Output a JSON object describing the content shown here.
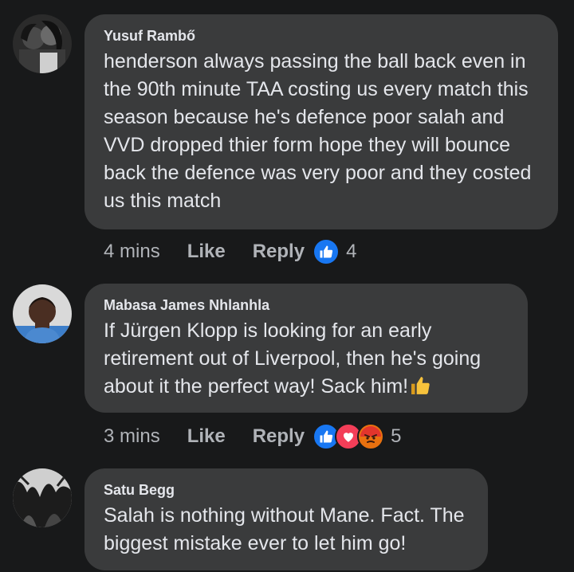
{
  "comments": [
    {
      "author": "Yusuf Rambő",
      "text": "henderson always passing the ball back even in the 90th minute TAA costing us every match this season because he's defence poor salah and VVD dropped thier form hope they will bounce back the defence was very poor and they costed us this match",
      "time": "4 mins",
      "like_label": "Like",
      "reply_label": "Reply",
      "reactions": [
        "like"
      ],
      "reaction_count": "4"
    },
    {
      "author": "Mabasa James Nhlanhla",
      "text": "If Jürgen Klopp is looking for an early retirement out of Liverpool, then he's going about it the perfect way! Sack him!",
      "time": "3 mins",
      "like_label": "Like",
      "reply_label": "Reply",
      "reactions": [
        "like",
        "love",
        "angry"
      ],
      "reaction_count": "5"
    },
    {
      "author": "Satu Begg",
      "text": "Salah is nothing without Mane. Fact. The biggest mistake ever to let him go!"
    }
  ],
  "colors": {
    "background": "#18191a",
    "bubble": "#3a3b3c",
    "text": "#e4e6eb",
    "secondary": "#b0b3b8",
    "like_blue": "#1877f2",
    "love_red": "#f33e58",
    "angry_orange": "#e9710f"
  },
  "icons": {
    "thumbs_up_emoji": "thumbs-up-emoji-icon",
    "like_reaction": "like-reaction-icon",
    "love_reaction": "love-reaction-icon",
    "angry_reaction": "angry-reaction-icon"
  }
}
